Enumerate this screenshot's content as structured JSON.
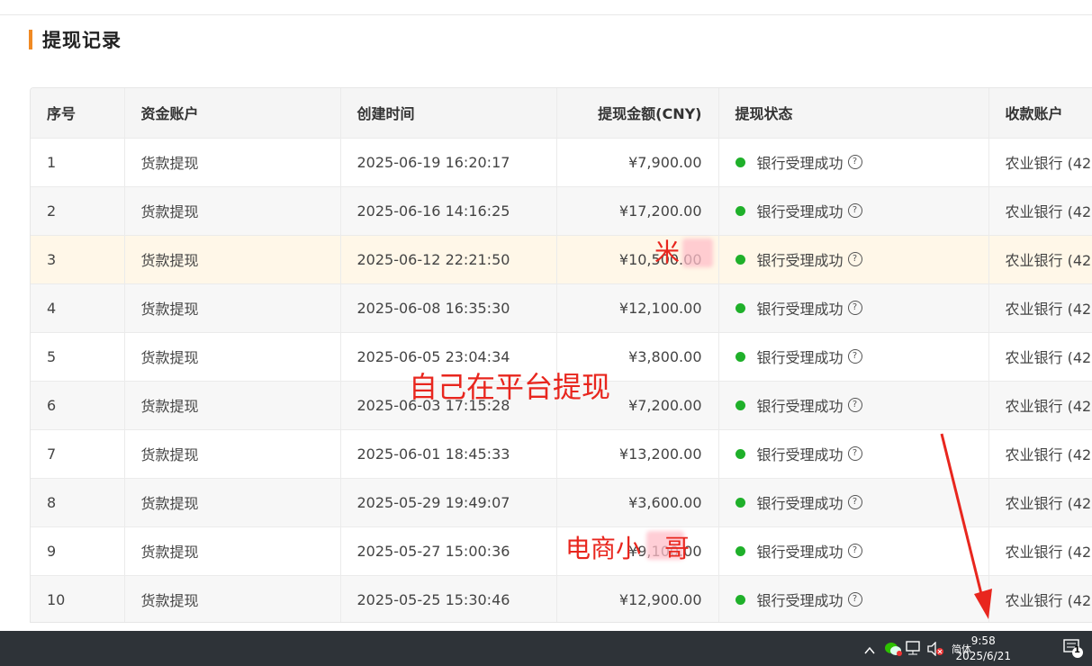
{
  "section": {
    "title": "提现记录"
  },
  "table": {
    "headers": [
      "序号",
      "资金账户",
      "创建时间",
      "提现金额(CNY)",
      "提现状态",
      "收款账户"
    ],
    "rows": [
      {
        "no": "1",
        "account": "货款提现",
        "time": "2025-06-19 16:20:17",
        "amount": "¥7,900.00",
        "status": "银行受理成功",
        "payee": "农业银行 (42"
      },
      {
        "no": "2",
        "account": "货款提现",
        "time": "2025-06-16 14:16:25",
        "amount": "¥17,200.00",
        "status": "银行受理成功",
        "payee": "农业银行 (42"
      },
      {
        "no": "3",
        "account": "货款提现",
        "time": "2025-06-12 22:21:50",
        "amount": "¥10,500.00",
        "status": "银行受理成功",
        "payee": "农业银行 (42"
      },
      {
        "no": "4",
        "account": "货款提现",
        "time": "2025-06-08 16:35:30",
        "amount": "¥12,100.00",
        "status": "银行受理成功",
        "payee": "农业银行 (42"
      },
      {
        "no": "5",
        "account": "货款提现",
        "time": "2025-06-05 23:04:34",
        "amount": "¥3,800.00",
        "status": "银行受理成功",
        "payee": "农业银行 (42"
      },
      {
        "no": "6",
        "account": "货款提现",
        "time": "2025-06-03 17:15:28",
        "amount": "¥7,200.00",
        "status": "银行受理成功",
        "payee": "农业银行 (42"
      },
      {
        "no": "7",
        "account": "货款提现",
        "time": "2025-06-01 18:45:33",
        "amount": "¥13,200.00",
        "status": "银行受理成功",
        "payee": "农业银行 (42"
      },
      {
        "no": "8",
        "account": "货款提现",
        "time": "2025-05-29 19:49:07",
        "amount": "¥3,600.00",
        "status": "银行受理成功",
        "payee": "农业银行 (42"
      },
      {
        "no": "9",
        "account": "货款提现",
        "time": "2025-05-27 15:00:36",
        "amount": "¥9,100.00",
        "status": "银行受理成功",
        "payee": "农业银行 (42"
      },
      {
        "no": "10",
        "account": "货款提现",
        "time": "2025-05-25 15:30:46",
        "amount": "¥12,900.00",
        "status": "银行受理成功",
        "payee": "农业银行 (42"
      }
    ]
  },
  "annotations": {
    "mi": "米",
    "self_withdraw": "自己在平台提现",
    "ecom": "电商小",
    "ecom_suffix": "哥"
  },
  "taskbar": {
    "ime": "简体",
    "time": "9:58",
    "date": "2025/6/21",
    "notif_count": "1"
  },
  "colors": {
    "accent": "#f08a24",
    "status_ok": "#1fb02a",
    "annotation": "#e8261e",
    "taskbar": "#2e3338"
  }
}
